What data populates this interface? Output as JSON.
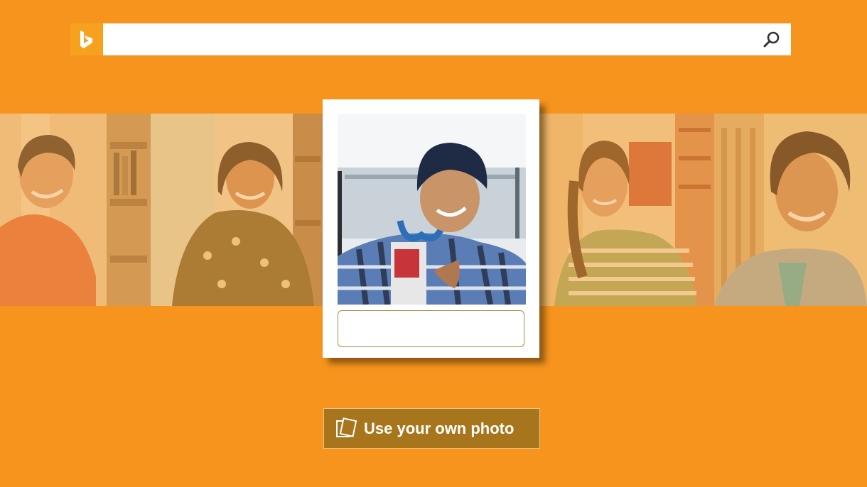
{
  "search": {
    "value": "",
    "placeholder": ""
  },
  "icons": {
    "logo": "bing-logo-icon",
    "search": "search-icon",
    "photo": "photo-stack-icon"
  },
  "caption": {
    "value": ""
  },
  "use_photo_button": {
    "label": "Use your own photo"
  },
  "colors": {
    "background": "#F7941D",
    "logo_bg": "#F6A21E",
    "button_bg": "#A7751B"
  }
}
